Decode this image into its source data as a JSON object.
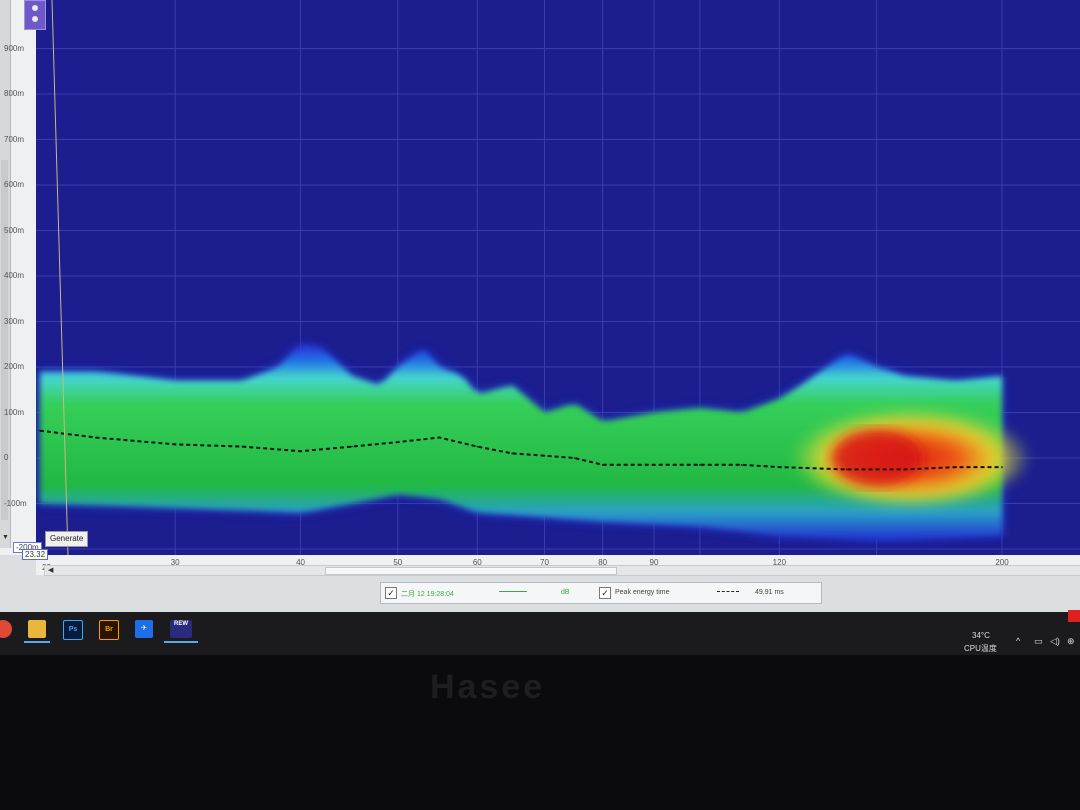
{
  "colors": {
    "plot_bg": "#1c1d8e",
    "cold": "#1f28c8",
    "mid": "#27c64a",
    "warm": "#f5e12b",
    "hot": "#d81818",
    "peak_line": "#1a1a1a"
  },
  "y_axis": {
    "ticks": [
      "900m",
      "800m",
      "700m",
      "600m",
      "500m",
      "400m",
      "300m",
      "200m",
      "100m",
      "0",
      "-100m"
    ],
    "min_label": "-200m"
  },
  "x_axis": {
    "min_label": "22",
    "cursor_value": "23.32",
    "ticks": [
      "30",
      "40",
      "50",
      "60",
      "70",
      "80",
      "90",
      "120",
      "200"
    ]
  },
  "toolbar": {
    "generate_label": "Generate"
  },
  "legend": {
    "entry1_date": "二月 12 19:28:04",
    "entry1_unit": "dB",
    "entry2_label": "Peak energy time",
    "entry2_value": "49.91 ms"
  },
  "taskbar": {
    "apps": [
      "Ps",
      "Br",
      "REW"
    ],
    "temperature": "34°C",
    "cpu_label": "CPU温度"
  },
  "bezel": {
    "brand": "Hasee"
  },
  "chart_data": {
    "type": "heatmap",
    "xlabel": "",
    "ylabel": "",
    "x_scale": "log",
    "xlim": [
      22,
      200
    ],
    "ylim": [
      -0.2,
      0.95
    ],
    "series": [
      {
        "name": "Peak energy time",
        "x": [
          22,
          25,
          30,
          35,
          40,
          45,
          50,
          55,
          60,
          65,
          70,
          75,
          80,
          90,
          100,
          110,
          120,
          140,
          160,
          180,
          200
        ],
        "y": [
          0.06,
          0.045,
          0.03,
          0.025,
          0.015,
          0.025,
          0.035,
          0.045,
          0.025,
          0.01,
          0.005,
          0.0,
          -0.015,
          -0.015,
          -0.015,
          -0.015,
          -0.02,
          -0.025,
          -0.025,
          -0.02,
          -0.02
        ]
      }
    ],
    "upper_envelope": {
      "x": [
        22,
        25,
        30,
        35,
        38,
        40,
        42,
        45,
        48,
        50,
        53,
        55,
        58,
        60,
        65,
        70,
        75,
        80,
        90,
        100,
        110,
        120,
        130,
        140,
        150,
        160,
        180,
        200
      ],
      "y": [
        0.19,
        0.19,
        0.17,
        0.17,
        0.2,
        0.25,
        0.24,
        0.18,
        0.16,
        0.2,
        0.24,
        0.2,
        0.18,
        0.14,
        0.16,
        0.1,
        0.12,
        0.08,
        0.1,
        0.11,
        0.1,
        0.13,
        0.18,
        0.23,
        0.2,
        0.18,
        0.17,
        0.18
      ]
    },
    "lower_envelope": {
      "x": [
        22,
        30,
        40,
        50,
        55,
        60,
        70,
        80,
        100,
        120,
        150,
        200
      ],
      "y": [
        -0.1,
        -0.11,
        -0.12,
        -0.08,
        -0.09,
        -0.12,
        -0.13,
        -0.14,
        -0.15,
        -0.17,
        -0.18,
        -0.17
      ]
    },
    "hot_region": {
      "x": [
        120,
        200
      ],
      "y": [
        -0.06,
        0.08
      ]
    },
    "grid": true
  }
}
